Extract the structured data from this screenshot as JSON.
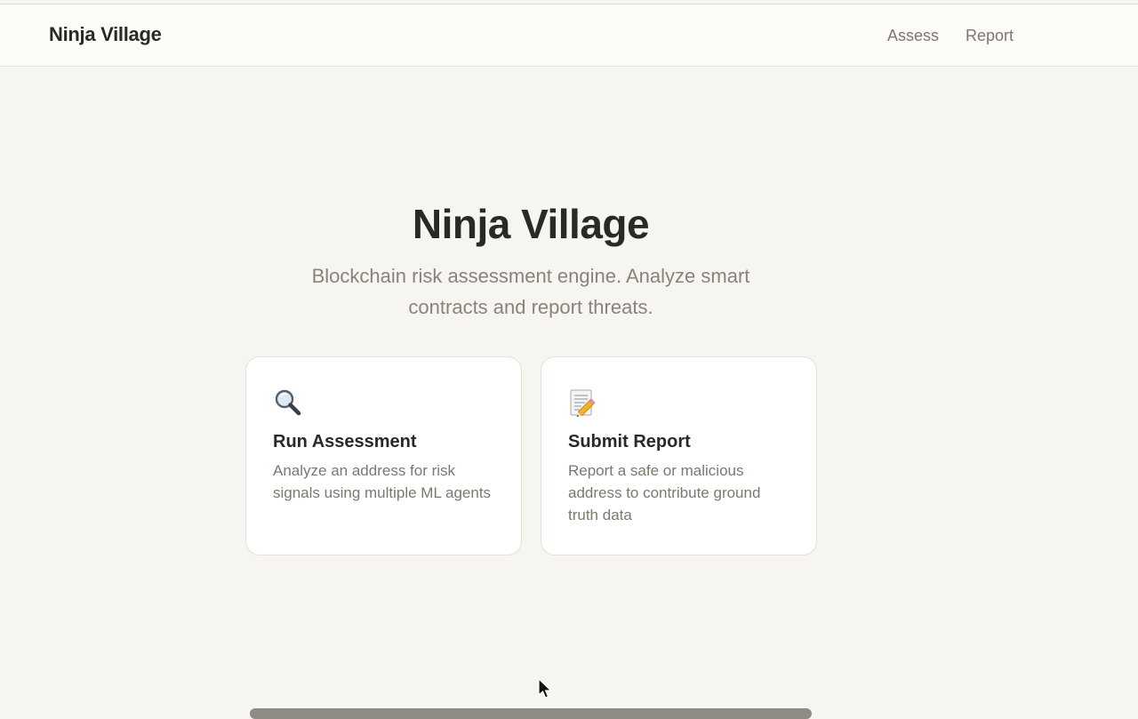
{
  "navbar": {
    "brand": "Ninja Village",
    "links": [
      "Assess",
      "Report"
    ]
  },
  "hero": {
    "title": "Ninja Village",
    "subtitle": "Blockchain risk assessment engine. Analyze smart contracts and report threats."
  },
  "cards": [
    {
      "icon": "magnifying-glass-icon",
      "title": "Run Assessment",
      "description": "Analyze an address for risk signals using multiple ML agents"
    },
    {
      "icon": "memo-icon",
      "title": "Submit Report",
      "description": "Report a safe or malicious address to contribute ground truth data"
    }
  ],
  "colors": {
    "background": "#f7f5f1",
    "text": "#2b2925",
    "muted": "#8a837a"
  }
}
